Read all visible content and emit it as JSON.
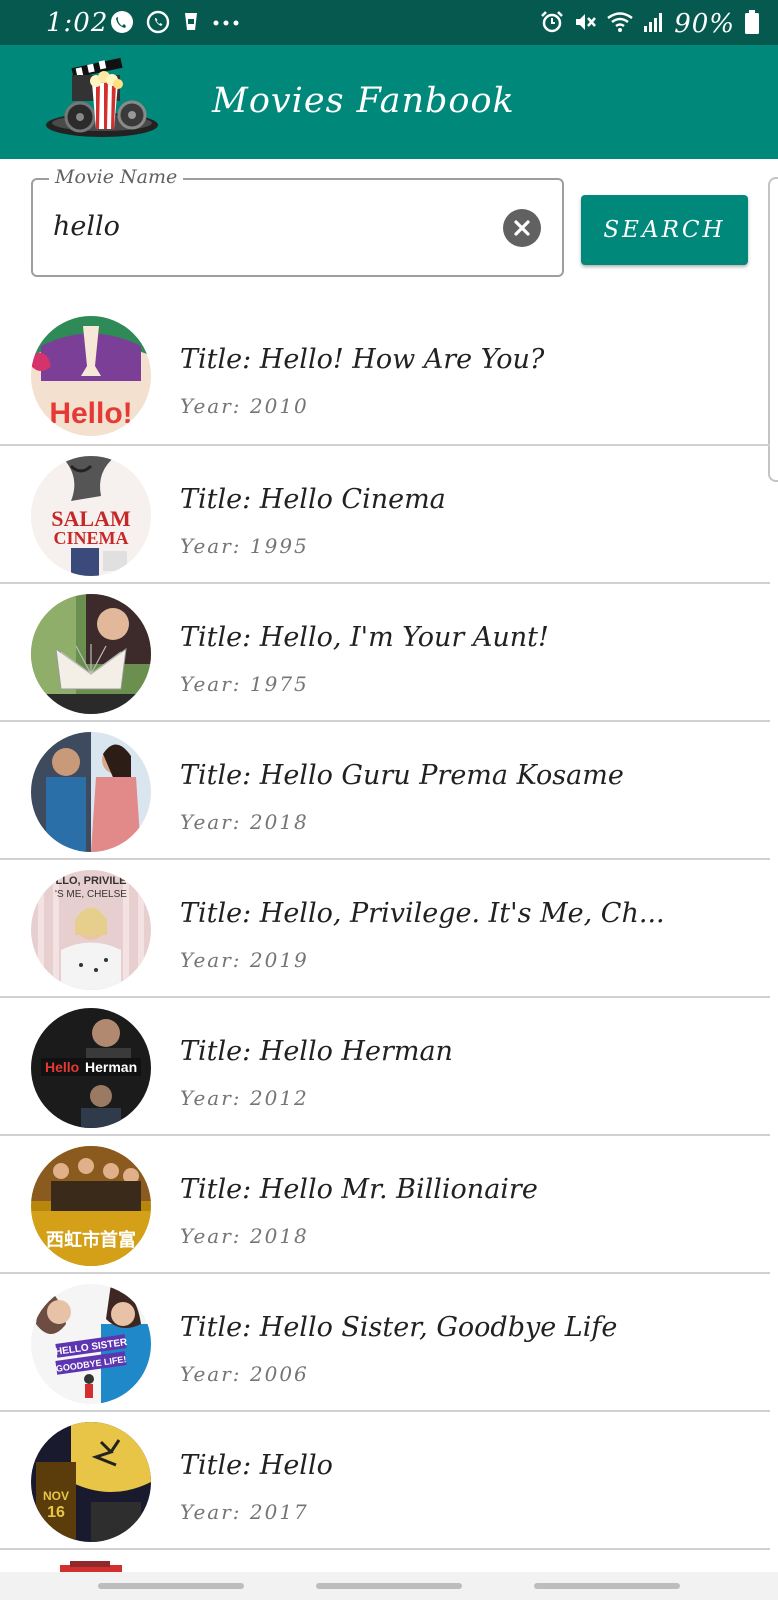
{
  "status_bar": {
    "time": "1:02",
    "battery": "90%",
    "left_icons": [
      "phone-call-icon",
      "whatsapp-icon",
      "cup-icon",
      "more-dots-icon"
    ],
    "right_icons": [
      "alarm-icon",
      "mute-icon",
      "wifi-icon",
      "signal-icon",
      "battery-icon"
    ]
  },
  "app_bar": {
    "title": "Movies Fanbook",
    "logo_icon": "movie-popcorn-logo-icon"
  },
  "search": {
    "label": "Movie Name",
    "value": "hello",
    "clear_icon": "clear-icon",
    "button_label": "SEARCH"
  },
  "movies": [
    {
      "title": "Title: Hello! How Are You?",
      "year": "Year: 2010",
      "poster": "poster-icon"
    },
    {
      "title": "Title: Hello Cinema",
      "year": "Year: 1995",
      "poster": "poster-icon"
    },
    {
      "title": "Title: Hello, I'm Your Aunt!",
      "year": "Year: 1975",
      "poster": "poster-icon"
    },
    {
      "title": "Title: Hello Guru Prema Kosame",
      "year": "Year: 2018",
      "poster": "poster-icon"
    },
    {
      "title": "Title: Hello, Privilege. It's Me, Ch...",
      "year": "Year: 2019",
      "poster": "poster-icon"
    },
    {
      "title": "Title: Hello Herman",
      "year": "Year: 2012",
      "poster": "poster-icon"
    },
    {
      "title": "Title: Hello Mr. Billionaire",
      "year": "Year: 2018",
      "poster": "poster-icon"
    },
    {
      "title": "Title: Hello Sister, Goodbye Life",
      "year": "Year: 2006",
      "poster": "poster-icon"
    },
    {
      "title": "Title: Hello",
      "year": "Year: 2017",
      "poster": "poster-icon"
    }
  ],
  "colors": {
    "status_bar": "#06594f",
    "primary": "#00897b",
    "divider": "#d0d0d0",
    "title_text": "#212121",
    "year_text": "#757575"
  }
}
